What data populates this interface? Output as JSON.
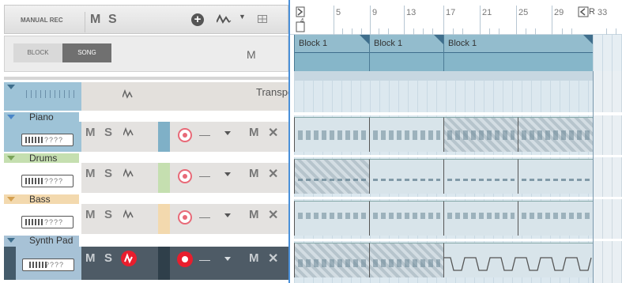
{
  "toolbar": {
    "manual_rec_label": "MANUAL REC",
    "mute_label": "M",
    "solo_label": "S",
    "add_icon": "plus-circle-icon",
    "automation_icon": "automation-wave-icon",
    "grid_icon": "grid-icon"
  },
  "view_toggle": {
    "block_label": "BLOCK",
    "song_label": "SONG",
    "selected": "SONG",
    "master_mute_label": "M"
  },
  "transport": {
    "label": "Transport",
    "icon": "automation-wave-icon"
  },
  "tracks": [
    {
      "name": "Piano",
      "color": "#9ec3d7",
      "mute": "M",
      "solo": "S",
      "armed": false
    },
    {
      "name": "Drums",
      "color": "#c5dfb0",
      "mute": "M",
      "solo": "S",
      "armed": false
    },
    {
      "name": "Bass",
      "color": "#f3d9ae",
      "mute": "M",
      "solo": "S",
      "armed": false
    },
    {
      "name": "Synth Pad",
      "color": "#a7c2d6",
      "mute": "M",
      "solo": "S",
      "armed": true
    }
  ],
  "track_controls": {
    "monitor_dash": "—",
    "mute": "M",
    "remove": "✕"
  },
  "ruler": {
    "bars": [
      "5",
      "9",
      "13",
      "17",
      "21",
      "25",
      "29",
      "33"
    ],
    "start_marker": "4",
    "end_marker_label": "R"
  },
  "blocks": [
    {
      "label": "Block 1"
    },
    {
      "label": "Block 1"
    },
    {
      "label": "Block 1"
    }
  ],
  "colors": {
    "accent_blue": "#4a90d9",
    "record_red": "#e81e2d",
    "block_blue": "#93bccd"
  }
}
